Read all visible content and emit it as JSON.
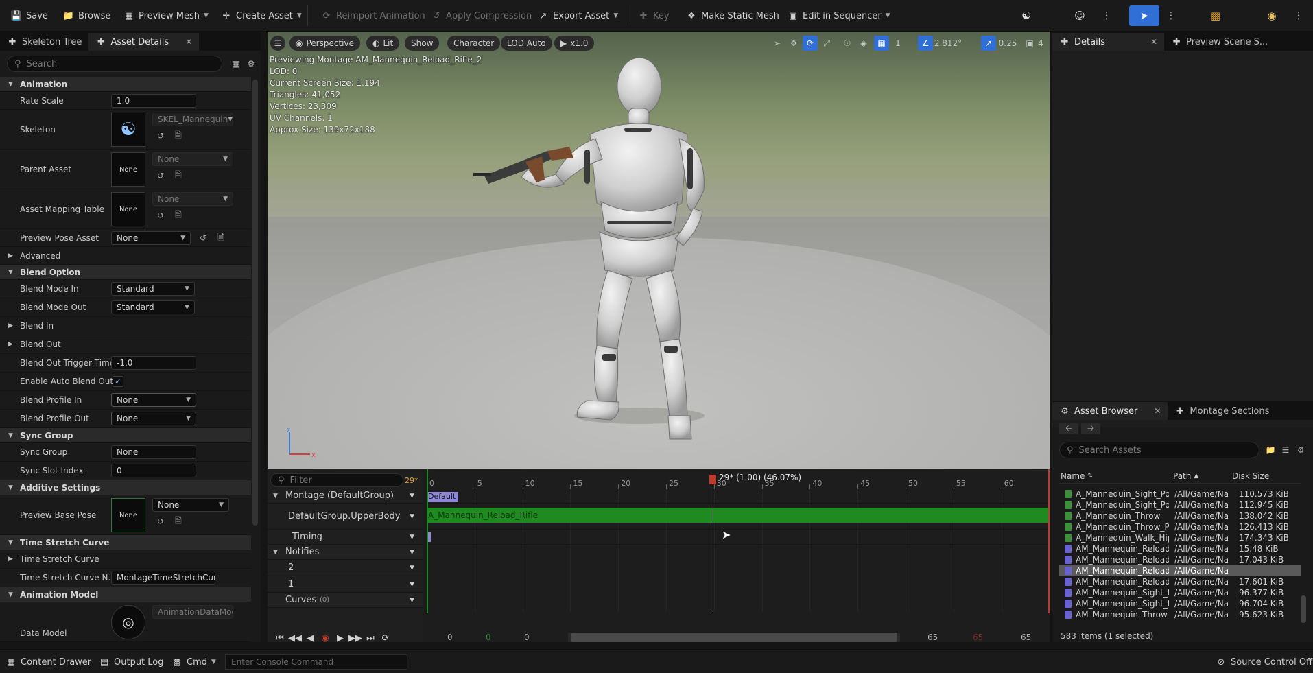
{
  "toolbar": {
    "save": "Save",
    "browse": "Browse",
    "preview_mesh": "Preview Mesh",
    "create_asset": "Create Asset",
    "reimport_animation": "Reimport Animation",
    "apply_compression": "Apply Compression",
    "export_asset": "Export Asset",
    "key": "Key",
    "make_static_mesh": "Make Static Mesh",
    "edit_in_sequencer": "Edit in Sequencer"
  },
  "left_tabs": {
    "skeleton_tree": "Skeleton Tree",
    "asset_details": "Asset Details"
  },
  "left_search": {
    "placeholder": "Search"
  },
  "props": {
    "animation": "Animation",
    "rate_scale": "Rate Scale",
    "rate_scale_val": "1.0",
    "skeleton": "Skeleton",
    "skeleton_val": "SKEL_Mannequin",
    "parent_asset": "Parent Asset",
    "parent_asset_val": "None",
    "thumb_none": "None",
    "asset_mapping_table": "Asset Mapping Table",
    "asset_mapping_val": "None",
    "preview_pose_asset": "Preview Pose Asset",
    "preview_pose_val": "None",
    "advanced": "Advanced",
    "blend_option": "Blend Option",
    "blend_mode_in": "Blend Mode In",
    "blend_mode_in_val": "Standard",
    "blend_mode_out": "Blend Mode Out",
    "blend_mode_out_val": "Standard",
    "blend_in": "Blend In",
    "blend_out": "Blend Out",
    "blend_out_trigger_time": "Blend Out Trigger Time",
    "blend_out_trigger_val": "-1.0",
    "enable_auto_blend_out": "Enable Auto Blend Out",
    "blend_profile_in": "Blend Profile In",
    "blend_profile_in_val": "None",
    "blend_profile_out": "Blend Profile Out",
    "blend_profile_out_val": "None",
    "sync_group_cat": "Sync Group",
    "sync_group": "Sync Group",
    "sync_group_val": "None",
    "sync_slot_index": "Sync Slot Index",
    "sync_slot_val": "0",
    "additive_settings": "Additive Settings",
    "preview_base_pose": "Preview Base Pose",
    "preview_base_pose_val": "None",
    "time_stretch_curve_cat": "Time Stretch Curve",
    "time_stretch_curve": "Time Stretch Curve",
    "time_stretch_curve_name": "Time Stretch Curve N...",
    "time_stretch_curve_name_val": "MontageTimeStretchCurve",
    "animation_model": "Animation Model",
    "data_model": "Data Model",
    "data_model_val": "AnimationDataModel"
  },
  "viewport": {
    "perspective": "Perspective",
    "lit": "Lit",
    "show": "Show",
    "character": "Character",
    "lod_auto": "LOD Auto",
    "speed": "x1.0",
    "grid_val": "1",
    "angle_val": "2.812°",
    "scale_val": "0.25",
    "cam_val": "4",
    "info": [
      "Previewing Montage AM_Mannequin_Reload_Rifle_2",
      "LOD: 0",
      "Current Screen Size: 1.194",
      "Triangles: 41,052",
      "Vertices: 23,309",
      "UV Channels: 1",
      "Approx Size: 139x72x188"
    ]
  },
  "timeline": {
    "filter_placeholder": "Filter",
    "frame_badge": "29*",
    "playhead_label": "29* (1.00) (46.07%)",
    "ruler": [
      "0",
      "5",
      "10",
      "15",
      "20",
      "25",
      "30",
      "35",
      "40",
      "45",
      "50",
      "55",
      "60"
    ],
    "montage": "Montage (DefaultGroup)",
    "upper_body": "DefaultGroup.UpperBody",
    "timing": "Timing",
    "notifies": "Notifies",
    "track_2": "2",
    "track_1": "1",
    "curves": "Curves",
    "curves_count": "(0)",
    "default_section": "Default",
    "segment_label": "A_Mannequin_Reload_Rifle",
    "bottom_nums": [
      "0",
      "0",
      "0",
      "65",
      "65",
      "65"
    ]
  },
  "right_tabs": {
    "details": "Details",
    "preview_scene": "Preview Scene S..."
  },
  "asset_browser": {
    "tab": "Asset Browser",
    "tab2": "Montage Sections",
    "search_placeholder": "Search Assets",
    "col_name": "Name",
    "col_path": "Path",
    "col_size": "Disk Size",
    "rows": [
      {
        "name": "A_Mannequin_Sight_Pos",
        "path": "/All/Game/Na",
        "size": "110.573 KiB",
        "kind": "anim"
      },
      {
        "name": "A_Mannequin_Sight_Pos",
        "path": "/All/Game/Na",
        "size": "112.945 KiB",
        "kind": "anim"
      },
      {
        "name": "A_Mannequin_Throw",
        "path": "/All/Game/Na",
        "size": "138.042 KiB",
        "kind": "anim"
      },
      {
        "name": "A_Mannequin_Throw_Po",
        "path": "/All/Game/Na",
        "size": "126.413 KiB",
        "kind": "anim"
      },
      {
        "name": "A_Mannequin_Walk_Hip",
        "path": "/All/Game/Na",
        "size": "174.343 KiB",
        "kind": "anim"
      },
      {
        "name": "AM_Mannequin_Reload_",
        "path": "/All/Game/Na",
        "size": "15.48 KiB",
        "kind": "montage"
      },
      {
        "name": "AM_Mannequin_Reload_",
        "path": "/All/Game/Na",
        "size": "17.043 KiB",
        "kind": "montage"
      },
      {
        "name": "AM_Mannequin_Reload_",
        "path": "/All/Game/Na",
        "size": "",
        "kind": "montage"
      },
      {
        "name": "AM_Mannequin_Reload_",
        "path": "/All/Game/Na",
        "size": "17.601 KiB",
        "kind": "montage"
      },
      {
        "name": "AM_Mannequin_Sight_F",
        "path": "/All/Game/Na",
        "size": "96.377 KiB",
        "kind": "montage"
      },
      {
        "name": "AM_Mannequin_Sight_F",
        "path": "/All/Game/Na",
        "size": "96.704 KiB",
        "kind": "montage"
      },
      {
        "name": "AM_Mannequin_Throw",
        "path": "/All/Game/Na",
        "size": "95.623 KiB",
        "kind": "montage"
      }
    ],
    "selected_index": 7,
    "footer": "583 items (1 selected)"
  },
  "statusbar": {
    "content_drawer": "Content Drawer",
    "output_log": "Output Log",
    "cmd": "Cmd",
    "console_placeholder": "Enter Console Command",
    "source_control": "Source Control Off"
  },
  "colors": {
    "accent": "#2f6fd6",
    "track_green": "#1f8a1f",
    "section_blue": "#8f88d8",
    "playhead": "#c0392b"
  }
}
